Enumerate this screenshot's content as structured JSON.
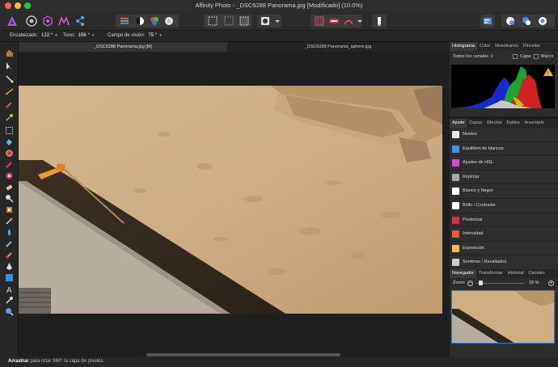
{
  "window": {
    "title": "Affinity Photo - _DSC6288 Panorama.jpg [Modificado] (10.0%)"
  },
  "context": {
    "heading_label": "Encabezado:",
    "heading_value": "122 °",
    "tilt_label": "Tono:",
    "tilt_value": "156 °",
    "fov_label": "Campo de visión:",
    "fov_value": "75 °"
  },
  "tabs": {
    "doc1": "_DSC6288 Panorama.jpg [M]",
    "doc2": "_DSC6288 Panorama_sphere.jpg"
  },
  "histogram_panel": {
    "tabs": [
      "Histograma",
      "Color",
      "Muestrarios",
      "Pinceles"
    ],
    "channel_select": "Todos los canales",
    "layer_label": "Capa",
    "marquee_label": "Marco"
  },
  "adjust_panel": {
    "tabs": [
      "Ajuste",
      "Capas",
      "Efectos",
      "Estilos",
      "Inventario"
    ],
    "items": [
      {
        "label": "Niveles",
        "color": "#e8e8e8"
      },
      {
        "label": "Equilibrio de blancos",
        "color": "#4a8fe0"
      },
      {
        "label": "Ajustes de HSL",
        "color": "#d44bd0"
      },
      {
        "label": "Repintar",
        "color": "#a8a8a8"
      },
      {
        "label": "Blanco y Negro",
        "color": "#ffffff"
      },
      {
        "label": "Brillo / Contraste",
        "color": "#ffffff"
      },
      {
        "label": "Posterizar",
        "color": "#d0324a"
      },
      {
        "label": "Intensidad",
        "color": "#e85a3a"
      },
      {
        "label": "Exposición",
        "color": "#f0c040"
      },
      {
        "label": "Sombras / Resaltados",
        "color": "#cccccc"
      }
    ]
  },
  "navigator_panel": {
    "tabs": [
      "Navegador",
      "Transformar",
      "Historial",
      "Canales"
    ],
    "zoom_label": "Zoom:",
    "zoom_value": "10 %"
  },
  "status": {
    "action": "Arrastrar",
    "hint": "para rotar 360° la capa de píxeles."
  },
  "colors": {
    "accent": "#3b7bd6",
    "sand": "#cdb08a"
  }
}
